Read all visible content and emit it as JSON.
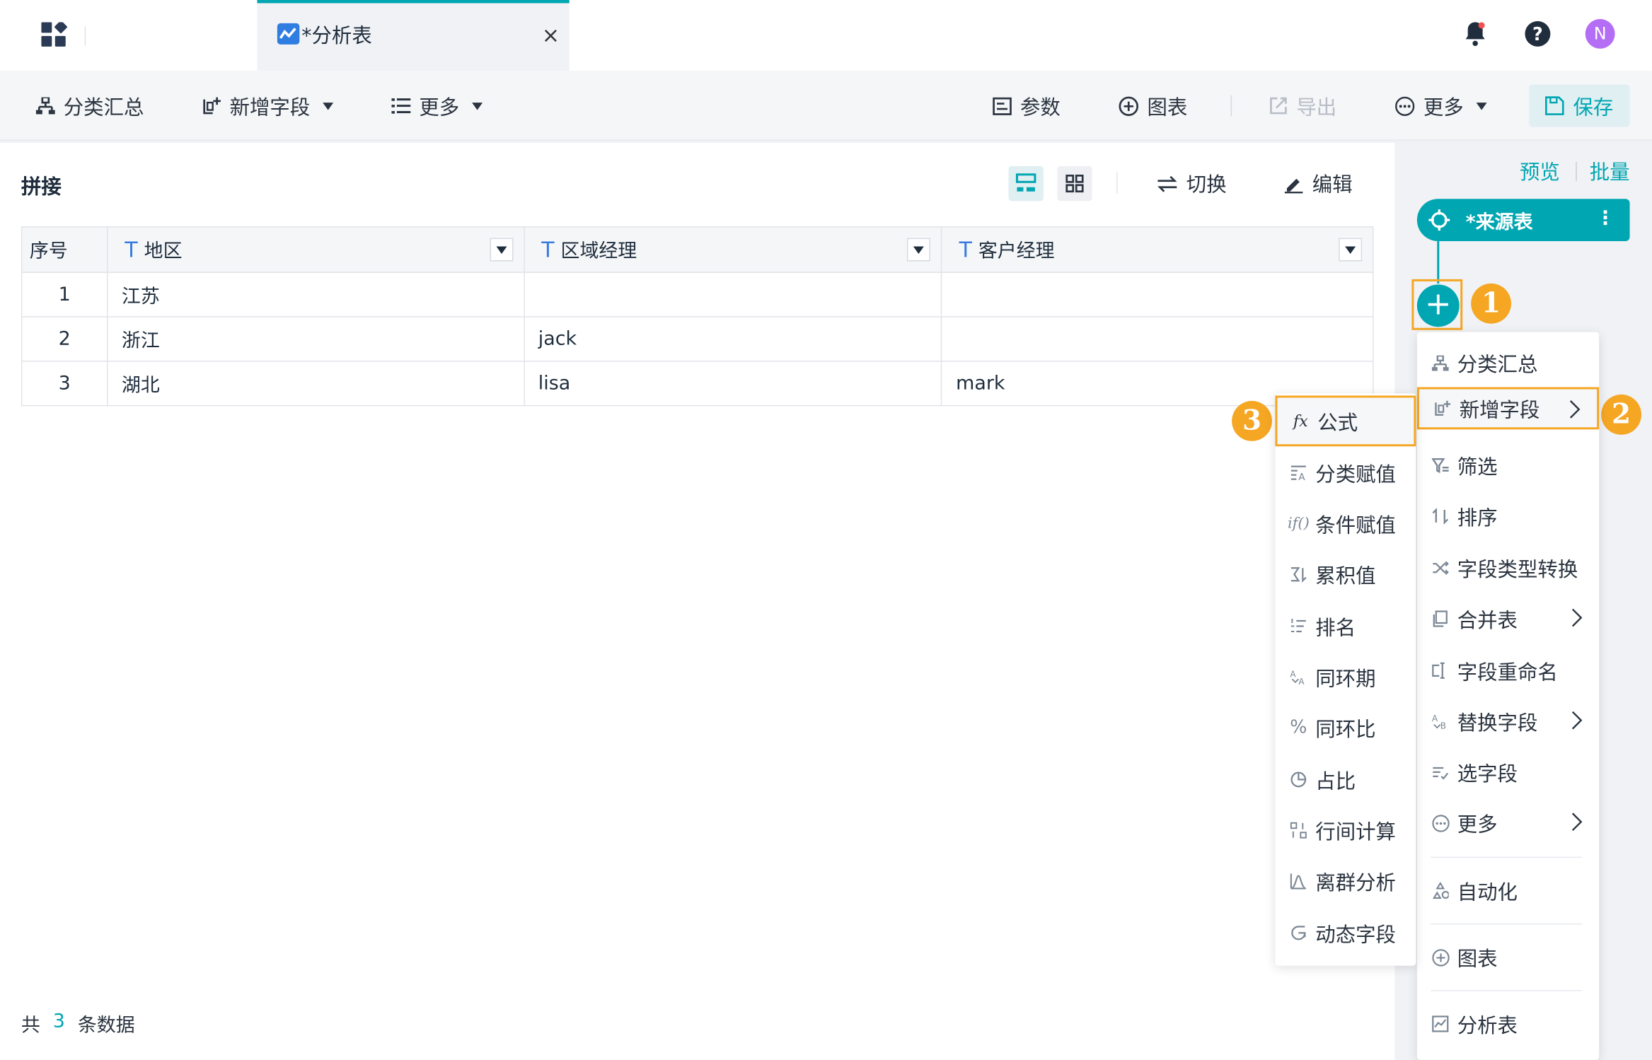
{
  "tab": {
    "title": "*分析表",
    "close": "×"
  },
  "user": {
    "avatar": "N"
  },
  "toolbar": {
    "group_summary": "分类汇总",
    "add_field": "新增字段",
    "more_left": "更多",
    "params": "参数",
    "chart": "图表",
    "export": "导出",
    "more_right": "更多",
    "save": "保存"
  },
  "panel": {
    "title": "拼接",
    "switch": "切换",
    "edit": "编辑"
  },
  "table": {
    "columns": [
      "序号",
      "地区",
      "区域经理",
      "客户经理"
    ],
    "type_glyph": "T",
    "rows": [
      [
        "1",
        "江苏",
        "",
        ""
      ],
      [
        "2",
        "浙江",
        "jack",
        ""
      ],
      [
        "3",
        "湖北",
        "lisa",
        "mark"
      ]
    ]
  },
  "footer": {
    "prefix": "共",
    "count": "3",
    "suffix": "条数据"
  },
  "flow": {
    "preview": "预览",
    "batch": "批量",
    "source_node": "*来源表",
    "node_menu": "⋮",
    "plus": "+"
  },
  "badges": [
    "1",
    "2",
    "3"
  ],
  "node_menu": {
    "items": [
      "分类汇总",
      "新增字段",
      "筛选",
      "排序",
      "字段类型转换",
      "合并表",
      "字段重命名",
      "替换字段",
      "选字段",
      "更多",
      "自动化",
      "图表",
      "分析表"
    ]
  },
  "submenu": {
    "items": [
      "公式",
      "分类赋值",
      "条件赋值",
      "累积值",
      "排名",
      "同环期",
      "同环比",
      "占比",
      "行间计算",
      "离群分析",
      "动态字段"
    ]
  },
  "colors": {
    "accent": "#00a6b2",
    "highlight": "#f5a623",
    "type_blue": "#3a7be0"
  }
}
